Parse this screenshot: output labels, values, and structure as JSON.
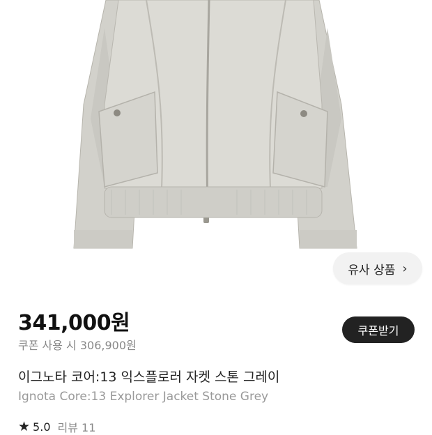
{
  "product": {
    "price": "341,000원",
    "coupon_price": "쿠폰 사용 시 306,900원",
    "coupon_button": "쿠폰받기",
    "title_ko": "이그노타 코어:13 익스플로러 자켓 스톤 그레이",
    "title_en": "Ignota Core:13 Explorer Jacket Stone Grey",
    "rating": "5.0",
    "reviews": "리뷰 11",
    "similar_button": "유사 상품",
    "similar_chevron": "›"
  },
  "icons": {
    "rating_star": "star-icon",
    "similar_chevron": "chevron-right-icon"
  },
  "colors": {
    "jacket": "#d6d4cc",
    "coupon_button_bg": "#222222",
    "secondary_text": "#888888"
  }
}
